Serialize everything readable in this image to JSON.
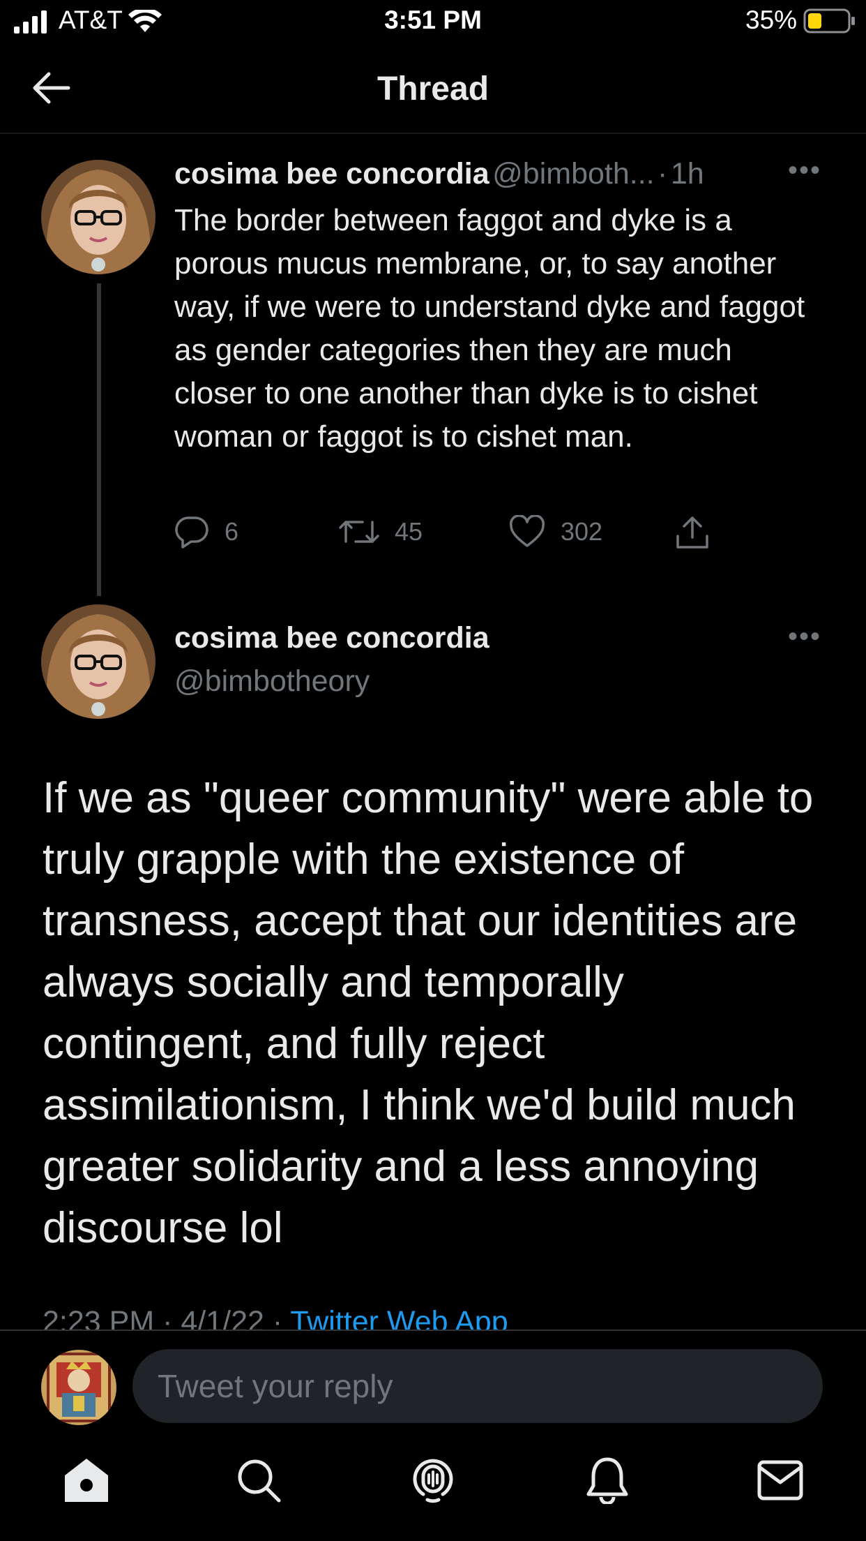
{
  "status_bar": {
    "carrier": "AT&T",
    "time": "3:51 PM",
    "battery_percent": "35%",
    "battery_level": 0.35
  },
  "header": {
    "back_icon": "arrow-left-icon",
    "title": "Thread"
  },
  "tweet1": {
    "name": "cosima bee concordia",
    "handle_truncated": "@bimboth...",
    "separator": "·",
    "time": "1h",
    "text": "The border between faggot and dyke is a porous mucus membrane, or, to say another way, if we were to understand dyke and faggot as gender categories then they are much closer to one another than dyke is to cishet woman or faggot is to cishet man.",
    "replies": "6",
    "retweets": "45",
    "likes": "302"
  },
  "tweet2": {
    "name": "cosima bee concordia",
    "handle": "@bimbotheory",
    "text": "If we as \"queer community\" were able to truly grapple with the existence of transness, accept that our identities are always socially and temporally contingent, and fully reject assimilationism, I think we'd build much greater solidarity and a less annoying discourse lol",
    "timestamp": "2:23 PM · 4/1/22 · ",
    "source": "Twitter Web App"
  },
  "reply": {
    "placeholder": "Tweet your reply"
  },
  "tabs": [
    {
      "icon": "home-icon"
    },
    {
      "icon": "search-icon"
    },
    {
      "icon": "spaces-icon"
    },
    {
      "icon": "notifications-icon"
    },
    {
      "icon": "messages-icon"
    }
  ],
  "colors": {
    "background": "#000000",
    "text_primary": "#e7e9ea",
    "text_secondary": "#71767b",
    "accent": "#1d9bf0",
    "battery_fill": "#ffd60a"
  }
}
